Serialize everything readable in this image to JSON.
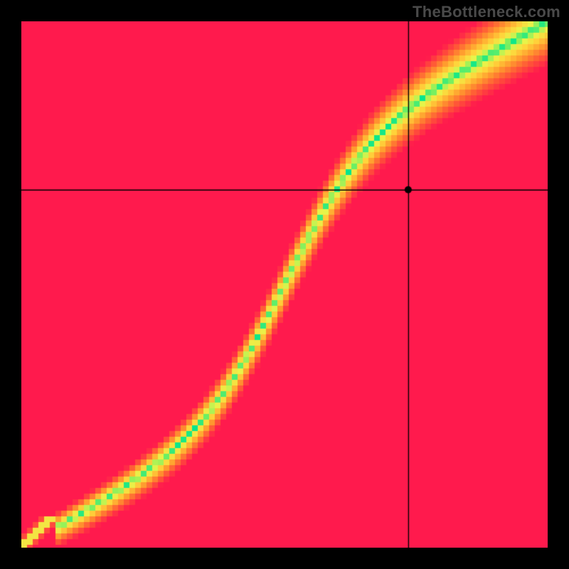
{
  "watermark": "TheBottleneck.com",
  "chart_data": {
    "type": "heatmap",
    "title": "",
    "xlabel": "",
    "ylabel": "",
    "xlim": [
      0,
      100
    ],
    "ylim": [
      0,
      100
    ],
    "crosshair": {
      "x": 73.5,
      "y": 68.0
    },
    "marker": {
      "x": 73.5,
      "y": 68.0
    },
    "optimal_curve_description": "S-shaped diagonal band where y roughly equals x with slight sigmoid bend; values near the band are optimal (green), moderate distance yellow/orange, far distance red",
    "colormap": {
      "stops": [
        {
          "t": 0.0,
          "color": "#00e68f"
        },
        {
          "t": 0.1,
          "color": "#7cf05e"
        },
        {
          "t": 0.2,
          "color": "#e8f44a"
        },
        {
          "t": 0.35,
          "color": "#ffd43b"
        },
        {
          "t": 0.55,
          "color": "#ff9a2e"
        },
        {
          "t": 0.75,
          "color": "#ff5a36"
        },
        {
          "t": 1.0,
          "color": "#ff1a4d"
        }
      ]
    },
    "band_halfwidth_fraction": 0.055,
    "grid": false,
    "legend": false
  }
}
